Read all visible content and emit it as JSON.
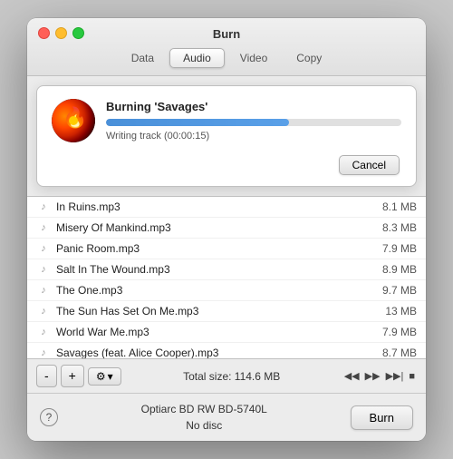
{
  "window": {
    "title": "Burn"
  },
  "tabs": [
    {
      "id": "data",
      "label": "Data",
      "active": false
    },
    {
      "id": "audio",
      "label": "Audio",
      "active": true
    },
    {
      "id": "video",
      "label": "Video",
      "active": false
    },
    {
      "id": "copy",
      "label": "Copy",
      "active": false
    }
  ],
  "progress_dialog": {
    "title": "Burning 'Savages'",
    "status": "Writing track (00:00:15)",
    "progress_percent": 62,
    "cancel_label": "Cancel"
  },
  "files": [
    {
      "name": "In Ruins.mp3",
      "size": "8.1 MB"
    },
    {
      "name": "Misery Of Mankind.mp3",
      "size": "8.3 MB"
    },
    {
      "name": "Panic Room.mp3",
      "size": "7.9 MB"
    },
    {
      "name": "Salt In The Wound.mp3",
      "size": "8.9 MB"
    },
    {
      "name": "The One.mp3",
      "size": "9.7 MB"
    },
    {
      "name": "The Sun Has Set On Me.mp3",
      "size": "13 MB"
    },
    {
      "name": "World War Me.mp3",
      "size": "7.9 MB"
    },
    {
      "name": "Savages (feat. Alice Cooper).mp3",
      "size": "8.7 MB"
    }
  ],
  "toolbar": {
    "remove_label": "-",
    "add_label": "+",
    "gear_label": "⚙",
    "chevron_label": "▾",
    "total_size_label": "Total size: 114.6 MB"
  },
  "playback": {
    "rewind": "◀◀",
    "fast_forward": "▶▶",
    "skip_forward": "▶▶|",
    "stop": "■"
  },
  "status_bar": {
    "help_label": "?",
    "device_name": "Optiarc BD RW BD-5740L",
    "device_status": "No disc",
    "burn_label": "Burn"
  }
}
